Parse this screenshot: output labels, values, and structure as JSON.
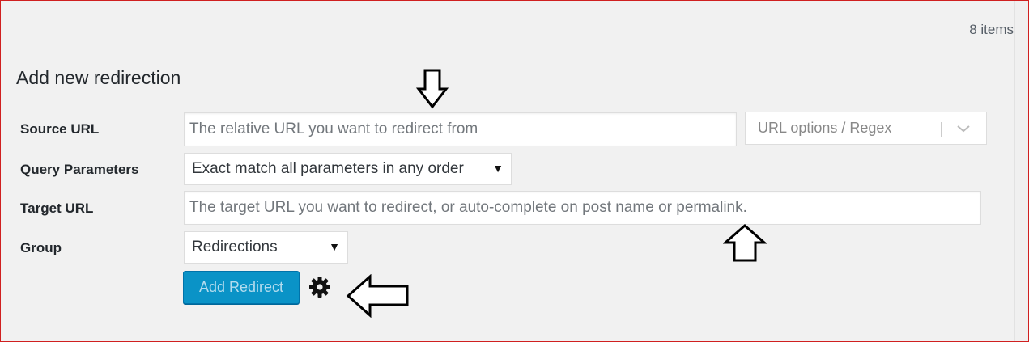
{
  "list": {
    "items_count": "8 items"
  },
  "form": {
    "heading": "Add new redirection",
    "source": {
      "label": "Source URL",
      "placeholder": "The relative URL you want to redirect from",
      "options_label": "URL options / Regex"
    },
    "query": {
      "label": "Query Parameters",
      "selected": "Exact match all parameters in any order"
    },
    "target": {
      "label": "Target URL",
      "placeholder": "The target URL you want to redirect, or auto-complete on post name or permalink."
    },
    "group": {
      "label": "Group",
      "selected": "Redirections"
    },
    "submit_label": "Add Redirect"
  },
  "colors": {
    "accent": "#0a93c7",
    "frame_border": "#d02020",
    "background": "#f1f1f1"
  },
  "icons": [
    "gear-icon",
    "chevron-down-icon",
    "select-arrow-icon",
    "annotation-arrow-down-icon",
    "annotation-arrow-up-icon",
    "annotation-arrow-left-icon"
  ]
}
